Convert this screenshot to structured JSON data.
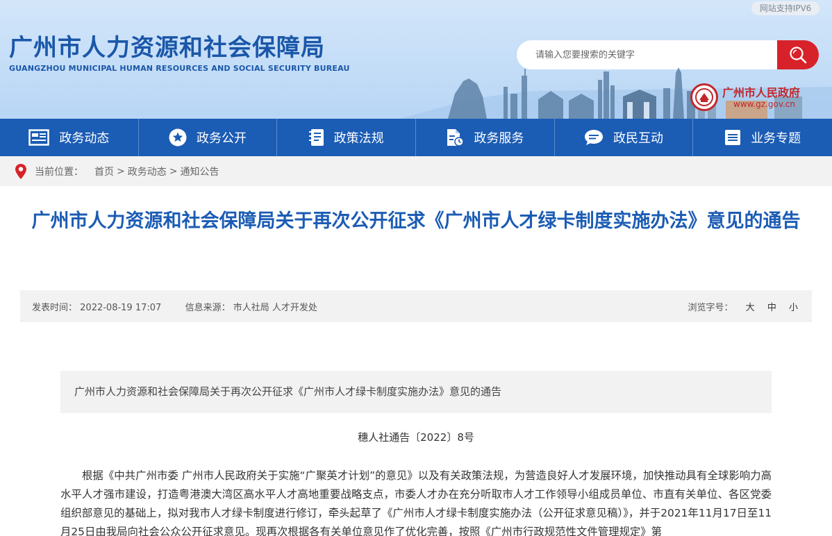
{
  "header": {
    "ipv6_badge": "网站支持IPV6",
    "title_cn": "广州市人力资源和社会保障局",
    "title_en": "GUANGZHOU MUNICIPAL HUMAN RESOURCES AND SOCIAL SECURITY BUREAU",
    "search": {
      "placeholder": "请输入您要搜索的关键字",
      "icon": "search-icon"
    },
    "gov": {
      "name": "广州市人民政府",
      "url": "www.gz.gov.cn"
    }
  },
  "nav": {
    "items": [
      {
        "label": "政务动态",
        "icon": "news-icon"
      },
      {
        "label": "政务公开",
        "icon": "star-icon"
      },
      {
        "label": "政策法规",
        "icon": "policy-document-icon"
      },
      {
        "label": "政务服务",
        "icon": "service-document-icon"
      },
      {
        "label": "政民互动",
        "icon": "chat-bubble-icon"
      },
      {
        "label": "业务专题",
        "icon": "topic-list-icon"
      }
    ]
  },
  "breadcrumb": {
    "label": "当前位置：",
    "items": [
      "首页",
      "政务动态",
      "通知公告"
    ],
    "separator": ">"
  },
  "article": {
    "title": "广州市人力资源和社会保障局关于再次公开征求《广州市人才绿卡制度实施办法》意见的通告",
    "meta": {
      "publish_label": "发表时间：",
      "publish_time": "2022-08-19 17:07",
      "source_label": "信息来源：",
      "source": "市人社局 人才开发处",
      "font_label": "浏览字号：",
      "font_sizes": [
        "大",
        "中",
        "小"
      ]
    },
    "subtitle": "广州市人力资源和社会保障局关于再次公开征求《广州市人才绿卡制度实施办法》意见的通告",
    "doc_number": "穗人社通告〔2022〕8号",
    "body": "根据《中共广州市委 广州市人民政府关于实施“广聚英才计划”的意见》以及有关政策法规，为营造良好人才发展环境，加快推动具有全球影响力高水平人才强市建设，打造粤港澳大湾区高水平人才高地重要战略支点，市委人才办在充分听取市人才工作领导小组成员单位、市直有关单位、各区党委组织部意见的基础上，拟对我市人才绿卡制度进行修订，牵头起草了《广州市人才绿卡制度实施办法（公开征求意见稿）》，并于2021年11月17日至11月25日由我局向社会公众公开征求意见。现再次根据各有关单位意见作了优化完善，按照《广州市行政规范性文件管理规定》第"
  },
  "colors": {
    "brand_blue": "#1b5cb4",
    "search_red": "#d8222a",
    "gov_red": "#c0282b",
    "header_bg": "#c6dff7"
  }
}
